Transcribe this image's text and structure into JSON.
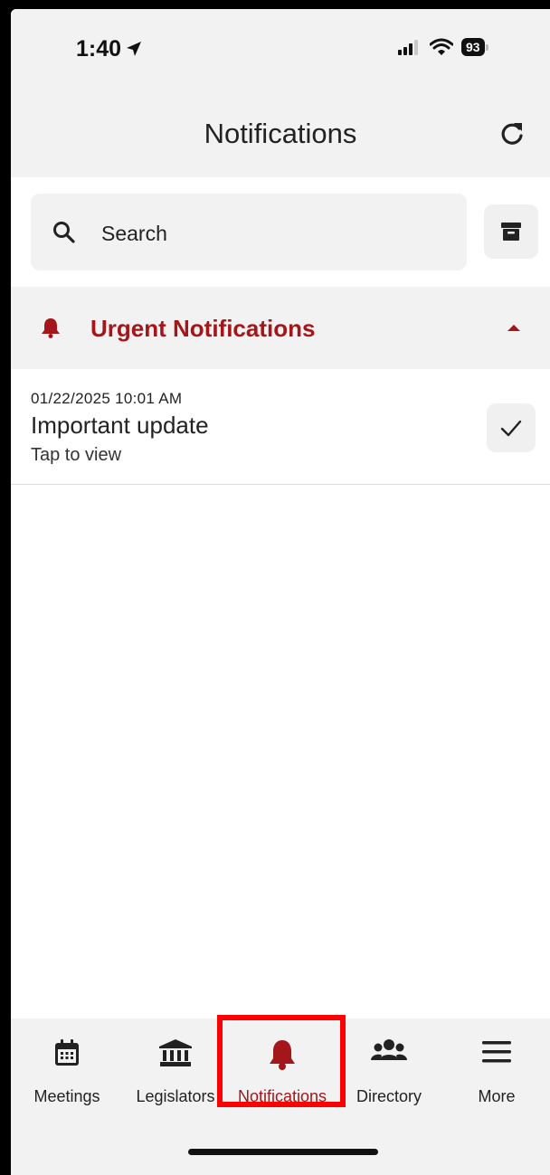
{
  "status_bar": {
    "time": "1:40",
    "battery": "93"
  },
  "header": {
    "title": "Notifications"
  },
  "search": {
    "placeholder": "Search"
  },
  "section": {
    "title": "Urgent Notifications"
  },
  "notifications": [
    {
      "timestamp": "01/22/2025 10:01 AM",
      "title": "Important update",
      "subtitle": "Tap to view"
    }
  ],
  "tabs": [
    {
      "label": "Meetings",
      "icon": "calendar-icon"
    },
    {
      "label": "Legislators",
      "icon": "capitol-building-icon"
    },
    {
      "label": "Notifications",
      "icon": "bell-icon",
      "active": true
    },
    {
      "label": "Directory",
      "icon": "users-icon"
    },
    {
      "label": "More",
      "icon": "menu-icon"
    }
  ],
  "colors": {
    "accent": "#a4161a",
    "highlight": "#ff0000",
    "surface": "#f2f2f2"
  }
}
